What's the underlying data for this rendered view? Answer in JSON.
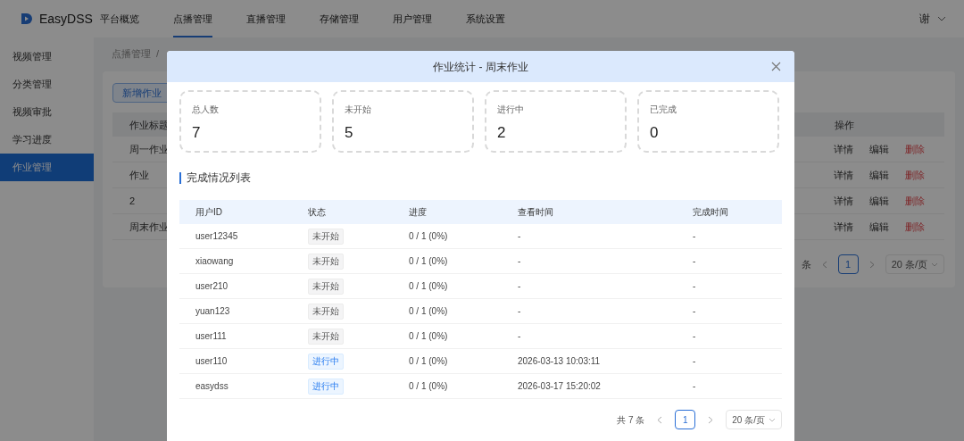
{
  "app": {
    "logo_text": "EasyDSS"
  },
  "top_nav": [
    {
      "label": "平台概览",
      "selected": false
    },
    {
      "label": "点播管理",
      "selected": true
    },
    {
      "label": "直播管理",
      "selected": false
    },
    {
      "label": "存储管理",
      "selected": false
    },
    {
      "label": "用户管理",
      "selected": false
    },
    {
      "label": "系统设置",
      "selected": false
    }
  ],
  "user_menu": {
    "label": "谢"
  },
  "sidebar": {
    "items": [
      {
        "label": "视频管理",
        "selected": false
      },
      {
        "label": "分类管理",
        "selected": false
      },
      {
        "label": "视频审批",
        "selected": false
      },
      {
        "label": "学习进度",
        "selected": false
      },
      {
        "label": "作业管理",
        "selected": true
      }
    ]
  },
  "breadcrumb": [
    "点播管理",
    "/"
  ],
  "page": {
    "add_button": "新增作业",
    "table": {
      "columns": [
        "作业标题",
        "操作"
      ],
      "rows": [
        {
          "title": "周一作业",
          "actions": [
            {
              "label": "详情",
              "kind": "normal"
            },
            {
              "label": "编辑",
              "kind": "normal"
            },
            {
              "label": "删除",
              "kind": "danger"
            }
          ]
        },
        {
          "title": "作业",
          "actions": [
            {
              "label": "详情",
              "kind": "normal"
            },
            {
              "label": "编辑",
              "kind": "normal"
            },
            {
              "label": "删除",
              "kind": "danger"
            }
          ]
        },
        {
          "title": "2",
          "actions": [
            {
              "label": "详情",
              "kind": "normal"
            },
            {
              "label": "编辑",
              "kind": "normal"
            },
            {
              "label": "删除",
              "kind": "danger"
            }
          ]
        },
        {
          "title": "周末作业",
          "actions": [
            {
              "label": "详情",
              "kind": "normal"
            },
            {
              "label": "编辑",
              "kind": "normal"
            },
            {
              "label": "删除",
              "kind": "danger"
            }
          ]
        }
      ]
    },
    "pagination": {
      "total": "条",
      "pages": [
        {
          "label": "1",
          "selected": true
        }
      ],
      "page_size": "20 条/页"
    }
  },
  "modal": {
    "title": "作业统计 - 周末作业",
    "stats": [
      {
        "label": "总人数",
        "value": "7"
      },
      {
        "label": "未开始",
        "value": "5"
      },
      {
        "label": "进行中",
        "value": "2"
      },
      {
        "label": "已完成",
        "value": "0"
      }
    ],
    "section_title": "完成情况列表",
    "table": {
      "columns": [
        "用户ID",
        "状态",
        "进度",
        "查看时间",
        "完成时间"
      ],
      "rows": [
        {
          "user_id": "user12345",
          "status": {
            "label": "未开始",
            "kind": "not_started"
          },
          "progress": "0 / 1 (0%)",
          "viewed_at": "-",
          "completed_at": "-"
        },
        {
          "user_id": "xiaowang",
          "status": {
            "label": "未开始",
            "kind": "not_started"
          },
          "progress": "0 / 1 (0%)",
          "viewed_at": "-",
          "completed_at": "-"
        },
        {
          "user_id": "user210",
          "status": {
            "label": "未开始",
            "kind": "not_started"
          },
          "progress": "0 / 1 (0%)",
          "viewed_at": "-",
          "completed_at": "-"
        },
        {
          "user_id": "yuan123",
          "status": {
            "label": "未开始",
            "kind": "not_started"
          },
          "progress": "0 / 1 (0%)",
          "viewed_at": "-",
          "completed_at": "-"
        },
        {
          "user_id": "user111",
          "status": {
            "label": "未开始",
            "kind": "not_started"
          },
          "progress": "0 / 1 (0%)",
          "viewed_at": "-",
          "completed_at": "-"
        },
        {
          "user_id": "user110",
          "status": {
            "label": "进行中",
            "kind": "in_progress"
          },
          "progress": "0 / 1 (0%)",
          "viewed_at": "2026-03-13 10:03:11",
          "completed_at": "-"
        },
        {
          "user_id": "easydss",
          "status": {
            "label": "进行中",
            "kind": "in_progress"
          },
          "progress": "0 / 1 (0%)",
          "viewed_at": "2026-03-17 15:20:02",
          "completed_at": "-"
        }
      ]
    },
    "pagination": {
      "total": "共 7 条",
      "pages": [
        {
          "label": "1",
          "selected": true
        }
      ],
      "page_size": "20 条/页"
    }
  }
}
